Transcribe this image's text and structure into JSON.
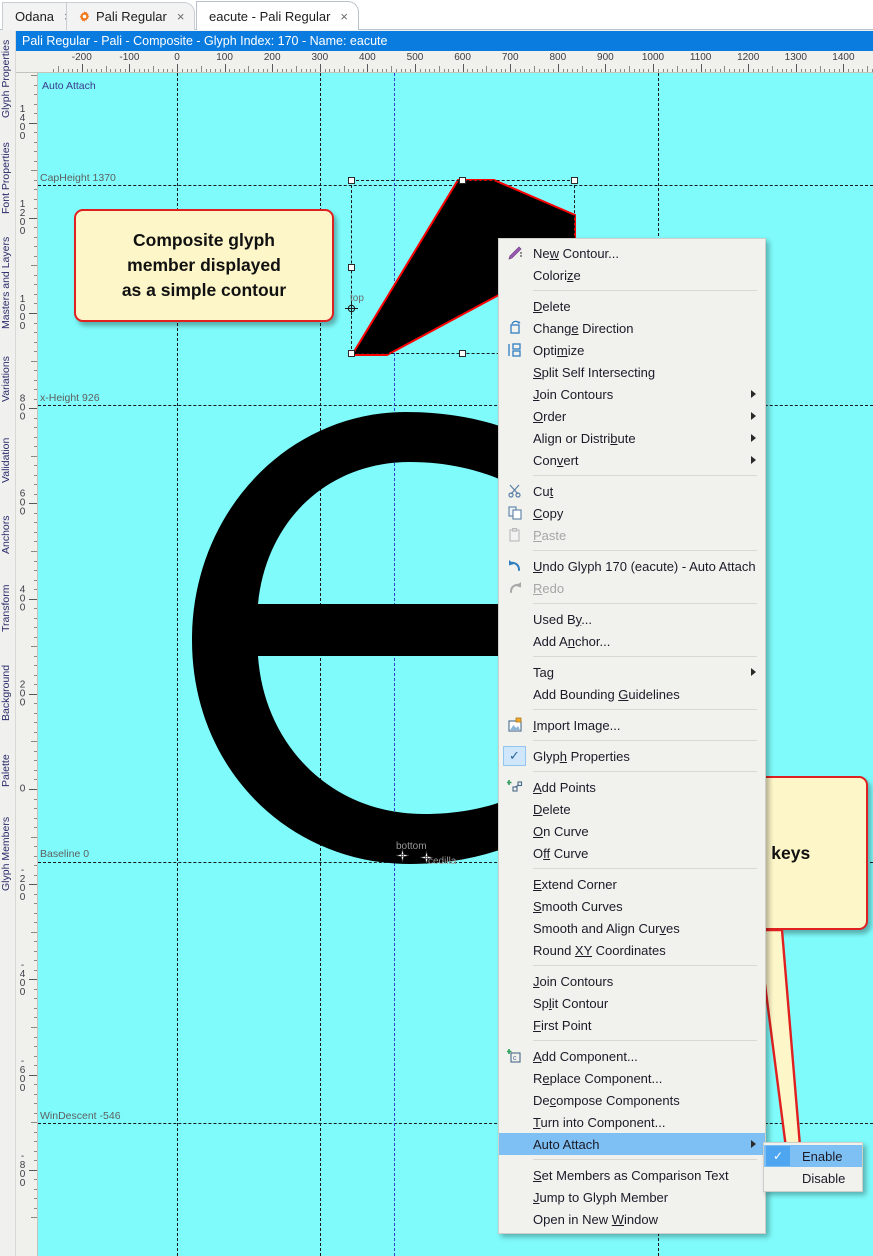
{
  "app": {
    "title_bar": "Pali Regular - Pali - Composite - Glyph Index: 170 - Name: eacute"
  },
  "tabs": [
    {
      "label": "Odana",
      "close": "×",
      "icon": "",
      "active": false
    },
    {
      "label": "Pali Regular",
      "close": "×",
      "icon": "gear-icon",
      "active": false
    },
    {
      "label": "eacute - Pali Regular",
      "close": "×",
      "icon": "",
      "active": true
    }
  ],
  "left_dock": [
    "Glyph Properties",
    "Font Properties",
    "Masters and Layers",
    "Variations",
    "Validation",
    "Anchors",
    "Transform",
    "Background",
    "Palette",
    "Glyph Members"
  ],
  "rulers": {
    "horizontal_labels": [
      "-200",
      "-100",
      "0",
      "100",
      "200",
      "300",
      "400",
      "500",
      "600",
      "700",
      "800",
      "900",
      "1000",
      "1100",
      "1200",
      "1300",
      "1400"
    ],
    "vertical_labels": [
      "1400",
      "1200",
      "1000",
      "800",
      "600",
      "400",
      "200",
      "0",
      "-200",
      "-400",
      "-600",
      "-800"
    ]
  },
  "canvas": {
    "background_color": "#7ffbfb",
    "guideline_labels": [
      {
        "name": "Auto Attach",
        "value": "",
        "text": "Auto Attach"
      },
      {
        "name": "CapHeight",
        "value": "1370",
        "text": "CapHeight 1370"
      },
      {
        "name": "x-Height",
        "value": "926",
        "text": "x-Height 926"
      },
      {
        "name": "Baseline",
        "value": "0",
        "text": "Baseline 0"
      },
      {
        "name": "WinDescent",
        "value": "-546",
        "text": "WinDescent -546"
      }
    ],
    "anchors": [
      {
        "label": "top"
      },
      {
        "label": "bottom"
      },
      {
        "label": "cedilla"
      }
    ]
  },
  "callouts": [
    {
      "id": "composite-note",
      "lines": [
        "Composite glyph",
        "member displayed",
        "as a simple contour"
      ]
    },
    {
      "id": "access-keys-note",
      "lines": [
        "No access keys"
      ]
    }
  ],
  "context_menu": {
    "items": [
      {
        "type": "item",
        "label": "New Contour...",
        "accel": "w",
        "icon": "pen-icon"
      },
      {
        "type": "item",
        "label": "Colorize",
        "accel": "z",
        "icon": ""
      },
      {
        "type": "sep"
      },
      {
        "type": "item",
        "label": "Delete",
        "accel": "D",
        "icon": ""
      },
      {
        "type": "item",
        "label": "Change Direction",
        "accel": "e",
        "icon": "change-direction-icon"
      },
      {
        "type": "item",
        "label": "Optimize",
        "accel": "m",
        "icon": "optimize-icon"
      },
      {
        "type": "item",
        "label": "Split Self Intersecting",
        "accel": "S",
        "icon": ""
      },
      {
        "type": "item",
        "label": "Join Contours",
        "accel": "J",
        "icon": "",
        "submenu": true
      },
      {
        "type": "item",
        "label": "Order",
        "accel": "O",
        "icon": "",
        "submenu": true
      },
      {
        "type": "item",
        "label": "Align or Distribute",
        "accel": "b",
        "icon": "",
        "submenu": true
      },
      {
        "type": "item",
        "label": "Convert",
        "accel": "v",
        "icon": "",
        "submenu": true
      },
      {
        "type": "sep"
      },
      {
        "type": "item",
        "label": "Cut",
        "accel": "t",
        "icon": "cut-icon"
      },
      {
        "type": "item",
        "label": "Copy",
        "accel": "C",
        "icon": "copy-icon"
      },
      {
        "type": "item",
        "label": "Paste",
        "accel": "P",
        "icon": "paste-icon",
        "disabled": true
      },
      {
        "type": "sep"
      },
      {
        "type": "item",
        "label": "Undo Glyph 170 (eacute) - Auto Attach",
        "accel": "U",
        "icon": "undo-icon"
      },
      {
        "type": "item",
        "label": "Redo",
        "accel": "R",
        "icon": "redo-icon",
        "disabled": true
      },
      {
        "type": "sep"
      },
      {
        "type": "item",
        "label": "Used By...",
        "accel": "y",
        "icon": ""
      },
      {
        "type": "item",
        "label": "Add Anchor...",
        "accel": "n",
        "icon": ""
      },
      {
        "type": "sep"
      },
      {
        "type": "item",
        "label": "Tag",
        "accel": "g",
        "icon": "",
        "submenu": true
      },
      {
        "type": "item",
        "label": "Add Bounding Guidelines",
        "accel": "G",
        "icon": ""
      },
      {
        "type": "sep"
      },
      {
        "type": "item",
        "label": "Import Image...",
        "accel": "I",
        "icon": "import-image-icon"
      },
      {
        "type": "sep"
      },
      {
        "type": "item",
        "label": "Glyph Properties",
        "accel": "h",
        "icon": "checkmark-icon",
        "checked": true
      },
      {
        "type": "sep"
      },
      {
        "type": "item",
        "label": "Add Points",
        "accel": "A",
        "icon": "add-points-icon"
      },
      {
        "type": "item",
        "label": "Delete",
        "accel": "D",
        "icon": ""
      },
      {
        "type": "item",
        "label": "On Curve",
        "accel": "O",
        "icon": ""
      },
      {
        "type": "item",
        "label": "Off Curve",
        "accel": "ff",
        "icon": ""
      },
      {
        "type": "sep"
      },
      {
        "type": "item",
        "label": "Extend Corner",
        "accel": "E",
        "icon": ""
      },
      {
        "type": "item",
        "label": "Smooth Curves",
        "accel": "S",
        "icon": ""
      },
      {
        "type": "item",
        "label": "Smooth and Align Curves",
        "accel": "v",
        "icon": ""
      },
      {
        "type": "item",
        "label": "Round XY Coordinates",
        "accel": "XY",
        "icon": ""
      },
      {
        "type": "sep"
      },
      {
        "type": "item",
        "label": "Join Contours",
        "accel": "J",
        "icon": ""
      },
      {
        "type": "item",
        "label": "Split Contour",
        "accel": "l",
        "icon": ""
      },
      {
        "type": "item",
        "label": "First Point",
        "accel": "F",
        "icon": ""
      },
      {
        "type": "sep"
      },
      {
        "type": "item",
        "label": "Add Component...",
        "accel": "A",
        "icon": "add-component-icon"
      },
      {
        "type": "item",
        "label": "Replace Component...",
        "accel": "e",
        "icon": ""
      },
      {
        "type": "item",
        "label": "Decompose Components",
        "accel": "c",
        "icon": ""
      },
      {
        "type": "item",
        "label": "Turn into Component...",
        "accel": "T",
        "icon": ""
      },
      {
        "type": "item",
        "label": "Auto Attach",
        "accel": "",
        "icon": "",
        "submenu": true,
        "selected": true
      },
      {
        "type": "sep"
      },
      {
        "type": "item",
        "label": "Set Members as Comparison Text",
        "accel": "S",
        "icon": ""
      },
      {
        "type": "item",
        "label": "Jump to Glyph Member",
        "accel": "J",
        "icon": ""
      },
      {
        "type": "item",
        "label": "Open in New Window",
        "accel": "W",
        "icon": ""
      }
    ]
  },
  "submenu": {
    "items": [
      {
        "label": "Enable",
        "checked": true,
        "selected": true
      },
      {
        "label": "Disable",
        "checked": false,
        "selected": false
      }
    ]
  },
  "colors": {
    "canvas": "#7ffbfb",
    "title_bar": "#0a7ce0",
    "menu_highlight": "#7fc0f4",
    "callout_fill": "#fdf6c8",
    "callout_border": "#e02020",
    "contour_outline": "#ff0000"
  }
}
